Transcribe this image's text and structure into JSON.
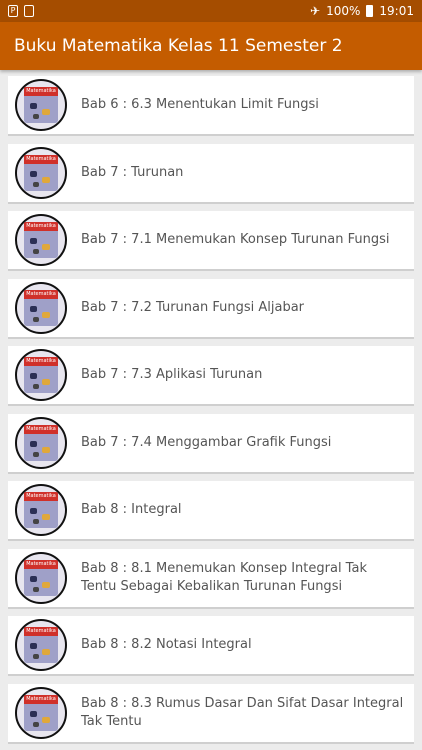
{
  "status": {
    "battery": "100%",
    "time": "19:01"
  },
  "app": {
    "title": "Buku Matematika Kelas 11 Semester 2"
  },
  "items": [
    {
      "label": "Bab 6 : 6.3 Menentukan Limit Fungsi"
    },
    {
      "label": "Bab 7 : Turunan"
    },
    {
      "label": "Bab 7 : 7.1 Menemukan Konsep Turunan Fungsi"
    },
    {
      "label": "Bab 7 : 7.2 Turunan Fungsi Aljabar"
    },
    {
      "label": "Bab 7 : 7.3 Aplikasi Turunan"
    },
    {
      "label": "Bab 7 : 7.4 Menggambar Grafik Fungsi"
    },
    {
      "label": "Bab 8 : Integral"
    },
    {
      "label": "Bab 8 : 8.1 Menemukan Konsep Integral Tak Tentu Sebagai Kebalikan Turunan Fungsi"
    },
    {
      "label": "Bab 8 : 8.2 Notasi Integral"
    },
    {
      "label": "Bab 8 : 8.3 Rumus Dasar Dan Sifat Dasar Integral Tak Tentu"
    }
  ],
  "thumb_text": "Matematika"
}
